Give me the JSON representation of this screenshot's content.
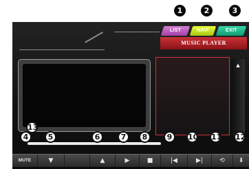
{
  "app": {
    "title": "MUSIC PLAYER",
    "tabs": [
      {
        "label": "LIST",
        "color": "#c256c0"
      },
      {
        "label": "NAVI",
        "color": "#c9e01f"
      },
      {
        "label": "EXIT",
        "color": "#1fba8a"
      }
    ]
  },
  "markers": {
    "m1": "1",
    "m2": "2",
    "m3": "3",
    "m4": "4",
    "m5": "5",
    "m6": "6",
    "m7": "7",
    "m8": "8",
    "m9": "9",
    "m10": "10",
    "m11": "11",
    "m12": "12",
    "m13": "13"
  },
  "controls": {
    "mute": "MUTE",
    "volume_down": "▼",
    "volume_up": "▲",
    "play": "▶",
    "stop": "■",
    "previous": "|◀",
    "next": "▶|",
    "repeat": "⟲",
    "scroll_down": "⬇",
    "scroll_up": "▲"
  },
  "icons": {
    "mute": "mute-icon",
    "volume_down": "volume-down-icon",
    "volume_up": "volume-up-icon",
    "play": "play-icon",
    "stop": "stop-icon",
    "previous": "previous-icon",
    "next": "next-icon",
    "repeat": "repeat-icon",
    "scroll_down": "scroll-down-icon",
    "scroll_up": "scroll-up-icon"
  },
  "progress": {
    "fraction": 0.0
  },
  "colors": {
    "accent_red": "#c0282e",
    "frame": "#1a1a1a"
  }
}
